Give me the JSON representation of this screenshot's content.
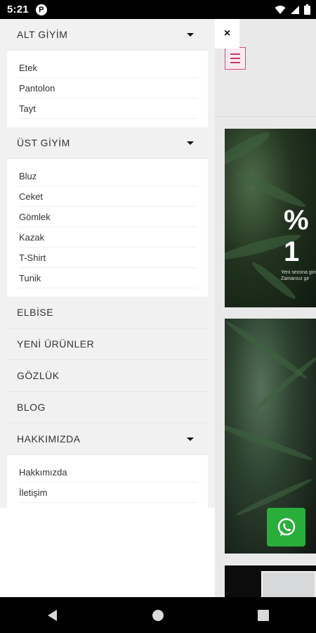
{
  "status_bar": {
    "time": "5:21",
    "app_badge": "P"
  },
  "drawer": {
    "categories": [
      {
        "label": "ALT GİYİM",
        "expanded": true,
        "items": [
          "Etek",
          "Pantolon",
          "Tayt"
        ]
      },
      {
        "label": "ÜST GİYİM",
        "expanded": true,
        "items": [
          "Bluz",
          "Ceket",
          "Gömlek",
          "Kazak",
          "T-Shirt",
          "Tunik"
        ]
      },
      {
        "label": "ELBİSE"
      },
      {
        "label": "YENİ ÜRÜNLER"
      },
      {
        "label": "GÖZLÜK"
      },
      {
        "label": "BLOG"
      },
      {
        "label": "HAKKIMIZDA",
        "expanded": true,
        "items": [
          "Hakkımızda",
          "İletişim"
        ]
      }
    ]
  },
  "page": {
    "close_symbol": "×",
    "promo_percent": "% 1",
    "promo_line1": "Yeni sezona giriş",
    "promo_line2": "Zamansız gir"
  },
  "colors": {
    "accent": "#d24c79",
    "whatsapp": "#2aae3b"
  }
}
